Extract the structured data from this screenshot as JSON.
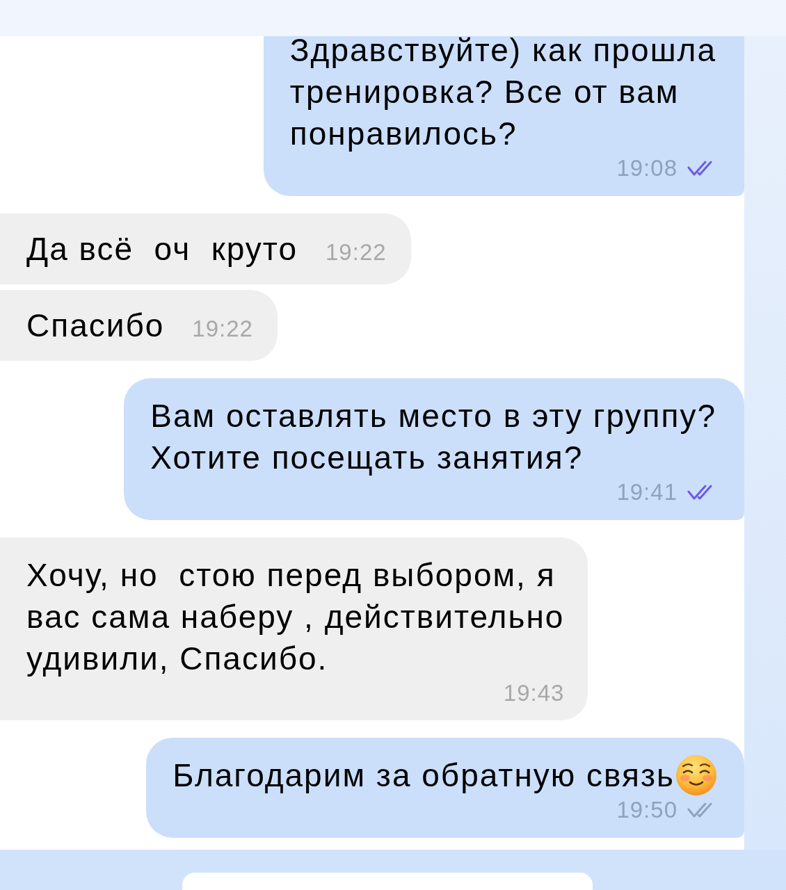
{
  "messages": [
    {
      "kind": "outgoing",
      "text": "Здравствуйте) как прошла\nтренировка? Все от вам\nпонравилось?",
      "time": "19:08",
      "read": true
    },
    {
      "kind": "incoming",
      "text": "Да всё  оч  круто",
      "time": "19:22"
    },
    {
      "kind": "incoming",
      "text": "Спасибо",
      "time": "19:22"
    },
    {
      "kind": "outgoing",
      "text": "Вам оставлять место в эту группу?\nХотите посещать занятия?",
      "time": "19:41",
      "read": true
    },
    {
      "kind": "incoming",
      "text": "Хочу, но  стою перед выбором, я\nвас сама наберу , действительно\nудивили, Спасибо.",
      "time": "19:43"
    },
    {
      "kind": "outgoing",
      "text": "Благодарим за обратную связь",
      "emoji": true,
      "time": "19:50",
      "read": false
    }
  ]
}
